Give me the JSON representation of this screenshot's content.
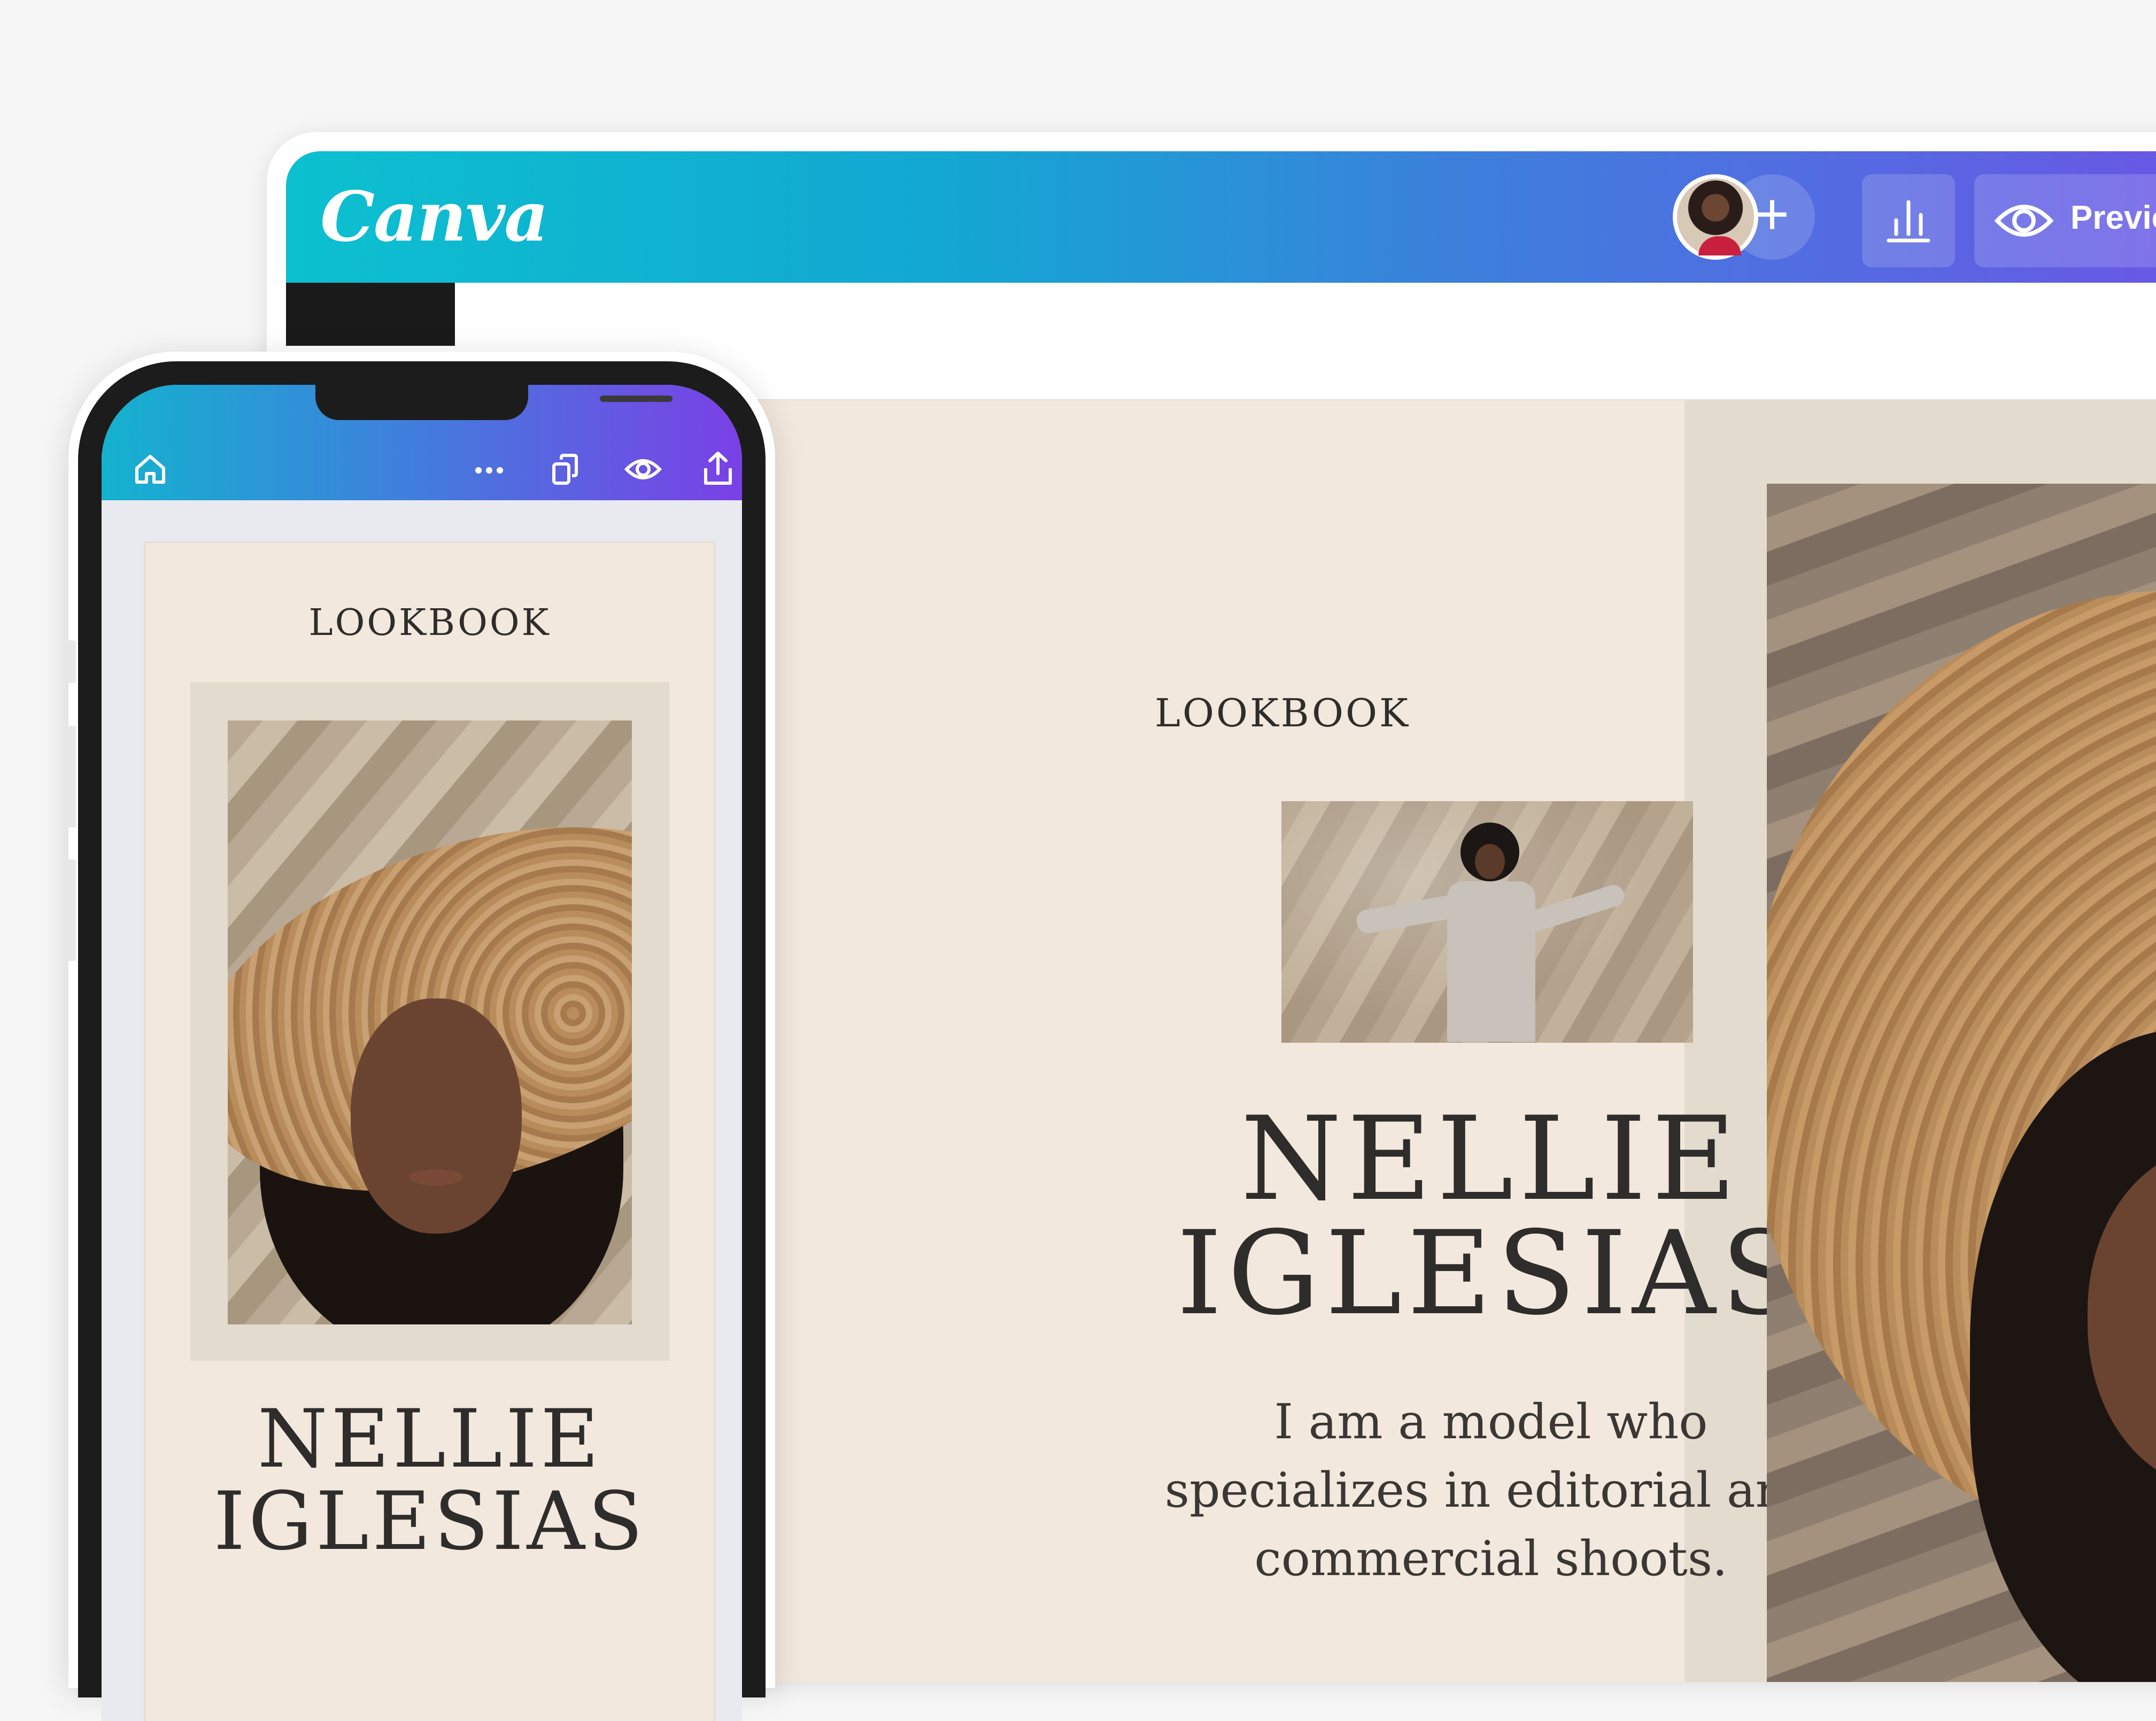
{
  "desktop": {
    "logo_text": "Canva",
    "toolbar": {
      "add_label": "+",
      "preview_label": "Previe"
    },
    "design": {
      "lookbook": "LOOKBOOK",
      "name_line1": "NELLIE",
      "name_line2": "IGLESIAS",
      "bio_line1": "I am a model who",
      "bio_line2": "specializes in editorial and",
      "bio_line3": "commercial shoots."
    }
  },
  "phone": {
    "toolbar_icons": [
      "home-icon",
      "more-icon",
      "pages-icon",
      "eye-icon",
      "share-icon"
    ],
    "design": {
      "lookbook": "LOOKBOOK",
      "name_line1": "NELLIE",
      "name_line2": "IGLESIAS"
    }
  },
  "colors": {
    "page_background": "#f3e8dd",
    "frame_background": "#e4dbcf",
    "header_gradient_start": "#0cc0cf",
    "header_gradient_end": "#6a57e6",
    "text": "#2f2d2b"
  }
}
